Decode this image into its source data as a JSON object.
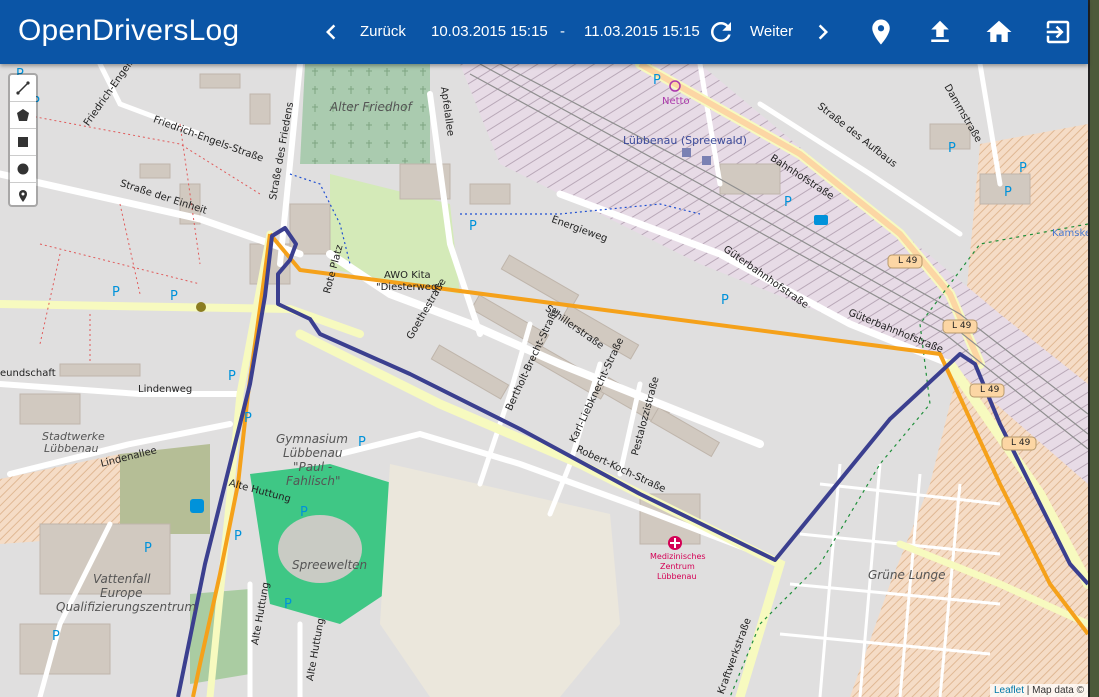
{
  "app": {
    "title": "OpenDriversLog"
  },
  "nav": {
    "back_label": "Zurück",
    "forward_label": "Weiter",
    "date_from": "10.03.2015 15:15",
    "separator": "-",
    "date_to": "11.03.2015 15:15"
  },
  "toolbar_icons": [
    "chevron-left-icon",
    "refresh-icon",
    "chevron-right-icon",
    "location-pin-icon",
    "upload-icon",
    "home-icon",
    "logout-icon"
  ],
  "draw_tools": [
    "polyline-icon",
    "polygon-icon",
    "rectangle-icon",
    "circle-icon",
    "marker-icon"
  ],
  "attribution": {
    "leaflet": "Leaflet",
    "separator": "|",
    "rest": "Map data ©"
  },
  "colors": {
    "appbar": "#0b55a6",
    "route_blue": "#3b3f8f",
    "route_orange": "#f5a11a"
  },
  "map_labels": {
    "alter_friedhof": "Alter Friedhof",
    "friedrich_engels_1": "Friedrich-Engels-Straße",
    "friedrich_engels_2": "Friedrich-Engels-Straße",
    "strasse_einheit": "Straße der Einheit",
    "strasse_friedens": "Straße des Friedens",
    "apfelallee": "Apfelallee",
    "netto": "Netto",
    "luebbenau": "Lübbenau (Spreewald)",
    "bahnhofstrasse": "Bahnhofstraße",
    "strasse_aufbaus": "Straße des Aufbaus",
    "dammstrasse": "Dammstraße",
    "energieweg": "Energieweg",
    "awo_kita": "AWO Kita",
    "diesterweg": "\"Diesterweg\"",
    "rote_platz": "Rote Platz",
    "gueterbahnhof_1": "Güterbahnhofstraße",
    "gueterbahnhof_2": "Güterbahnhofstraße",
    "goethestrasse": "Goethestraße",
    "schillerstrasse": "Schillerstraße",
    "lindenweg": "Lindenweg",
    "freundschaft": "eundschaft",
    "stadtwerke": "Stadtwerke",
    "stadtwerke2": "Lübbenau",
    "lindenallee": "Lindenallee",
    "gymnasium1": "Gymnasium",
    "gymnasium2": "Lübbenau",
    "gymnasium3": "\"Paul -",
    "gymnasium4": "Fahlisch\"",
    "alte_huttung_1": "Alte Huttung",
    "alte_huttung_2": "Alte Huttung",
    "alte_huttung_3": "Alte Huttung",
    "spreewelten": "Spreewelten",
    "vattenfall1": "Vattenfall",
    "vattenfall2": "Europe",
    "vattenfall3": "Qualifizierungszentrum",
    "brecht": "Bertholt-Brecht-Straße",
    "liebknecht": "Karl-Liebknecht-Straße",
    "pestalozzi": "Pestalozzistraße",
    "robert_koch": "Robert-Koch-Straße",
    "med1": "Medizinisches",
    "med2": "Zentrum",
    "med3": "Lübbenau",
    "gruene_lunge": "Grüne Lunge",
    "kraftwerk": "Kraftwerkstraße",
    "kamske": "Kamske",
    "l49_1": "L 49",
    "l49_2": "L 49",
    "l49_3": "L 49",
    "l49_4": "L 49"
  }
}
